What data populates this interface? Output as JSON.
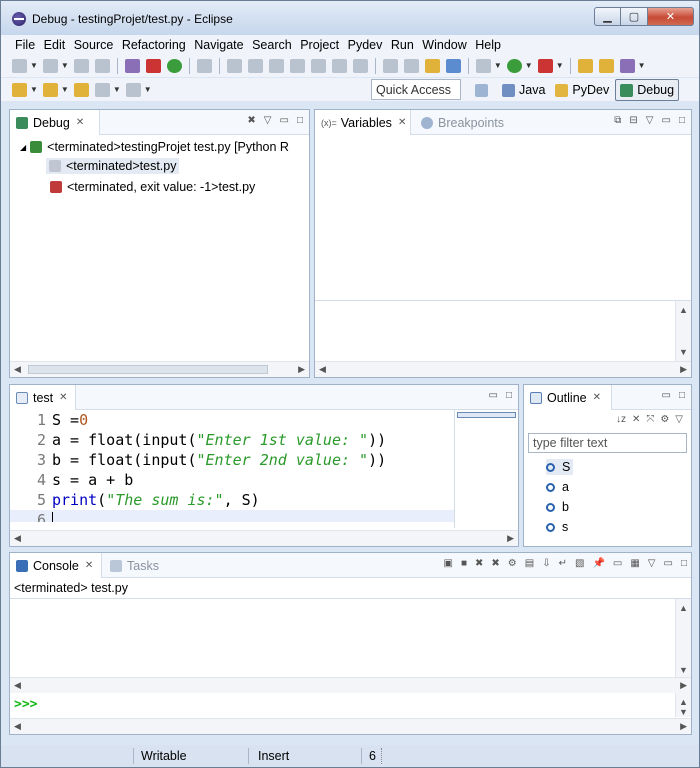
{
  "window": {
    "title": "Debug - testingProjet/test.py - Eclipse"
  },
  "menu": [
    "File",
    "Edit",
    "Source",
    "Refactoring",
    "Navigate",
    "Search",
    "Project",
    "Pydev",
    "Run",
    "Window",
    "Help"
  ],
  "toolbar": {
    "quick_access": "Quick Access"
  },
  "perspectives": [
    {
      "label": "Java",
      "active": false
    },
    {
      "label": "PyDev",
      "active": false
    },
    {
      "label": "Debug",
      "active": true
    }
  ],
  "debug_view": {
    "tab": "Debug",
    "tree": [
      "<terminated>testingProjet test.py [Python R",
      "<terminated>test.py",
      "<terminated, exit value: -1>test.py"
    ]
  },
  "variables_view": {
    "tabs": [
      "Variables",
      "Breakpoints"
    ]
  },
  "editor": {
    "tab": "test",
    "lines": [
      {
        "n": "1"
      },
      {
        "n": "2"
      },
      {
        "n": "3"
      },
      {
        "n": "4"
      },
      {
        "n": "5"
      },
      {
        "n": "6"
      }
    ],
    "code": {
      "l1": "S = ",
      "l1_num": "0",
      "l2a": "a = float(input(",
      "l2s": "\"Enter 1st value: \"",
      "l2b": "))",
      "l3a": "b = float(input(",
      "l3s": "\"Enter 2nd value: \"",
      "l3b": "))",
      "l4": "s = a + b",
      "l5kw": "print",
      "l5a": "(",
      "l5s": "\"The sum is:\"",
      "l5b": ", S)"
    }
  },
  "outline_view": {
    "tab": "Outline",
    "filter_placeholder": "type filter text",
    "items": [
      "S",
      "a",
      "b",
      "s"
    ]
  },
  "console_view": {
    "tabs": [
      "Console",
      "Tasks"
    ],
    "status": "<terminated> test.py",
    "prompt": ">>>"
  },
  "statusbar": {
    "mode": "Writable",
    "insert": "Insert",
    "line": "6"
  }
}
